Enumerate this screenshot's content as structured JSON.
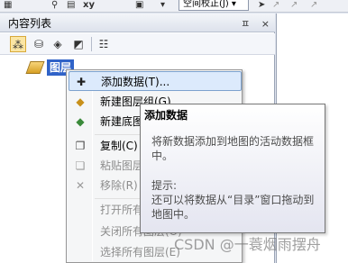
{
  "toolbar": {
    "spatial_adjust_dropdown": "空间校正(J) ▾"
  },
  "toc": {
    "title": "内容列表",
    "pin_glyph": "ㅍ",
    "close_glyph": "×",
    "layers_label": "图层"
  },
  "context_menu": {
    "items": [
      {
        "label": "添加数据(T)...",
        "icon": "add-data-icon",
        "enabled": true
      },
      {
        "label": "新建图层组(G)",
        "icon": "new-group-layer-icon",
        "enabled": true
      },
      {
        "label": "新建底图",
        "icon": "new-basemap-icon",
        "enabled": true
      },
      {
        "label": "复制(C)",
        "icon": "copy-icon",
        "enabled": true
      },
      {
        "label": "粘贴图层",
        "icon": "paste-icon",
        "enabled": false
      },
      {
        "label": "移除(R)",
        "icon": "remove-icon",
        "enabled": false
      },
      {
        "label": "打开所有",
        "icon": "",
        "enabled": false
      },
      {
        "label": "关闭所有图层(O)",
        "icon": "",
        "enabled": false
      },
      {
        "label": "选择所有图层(E)",
        "icon": "",
        "enabled": false
      }
    ]
  },
  "tooltip": {
    "title": "添加数据",
    "description": "将新数据添加到地图的活动数据框中。",
    "hint_title": "提示:",
    "hint": "还可以将数据从“目录”窗口拖动到地图中。"
  },
  "watermark": "CSDN @一蓑烟雨摆舟"
}
